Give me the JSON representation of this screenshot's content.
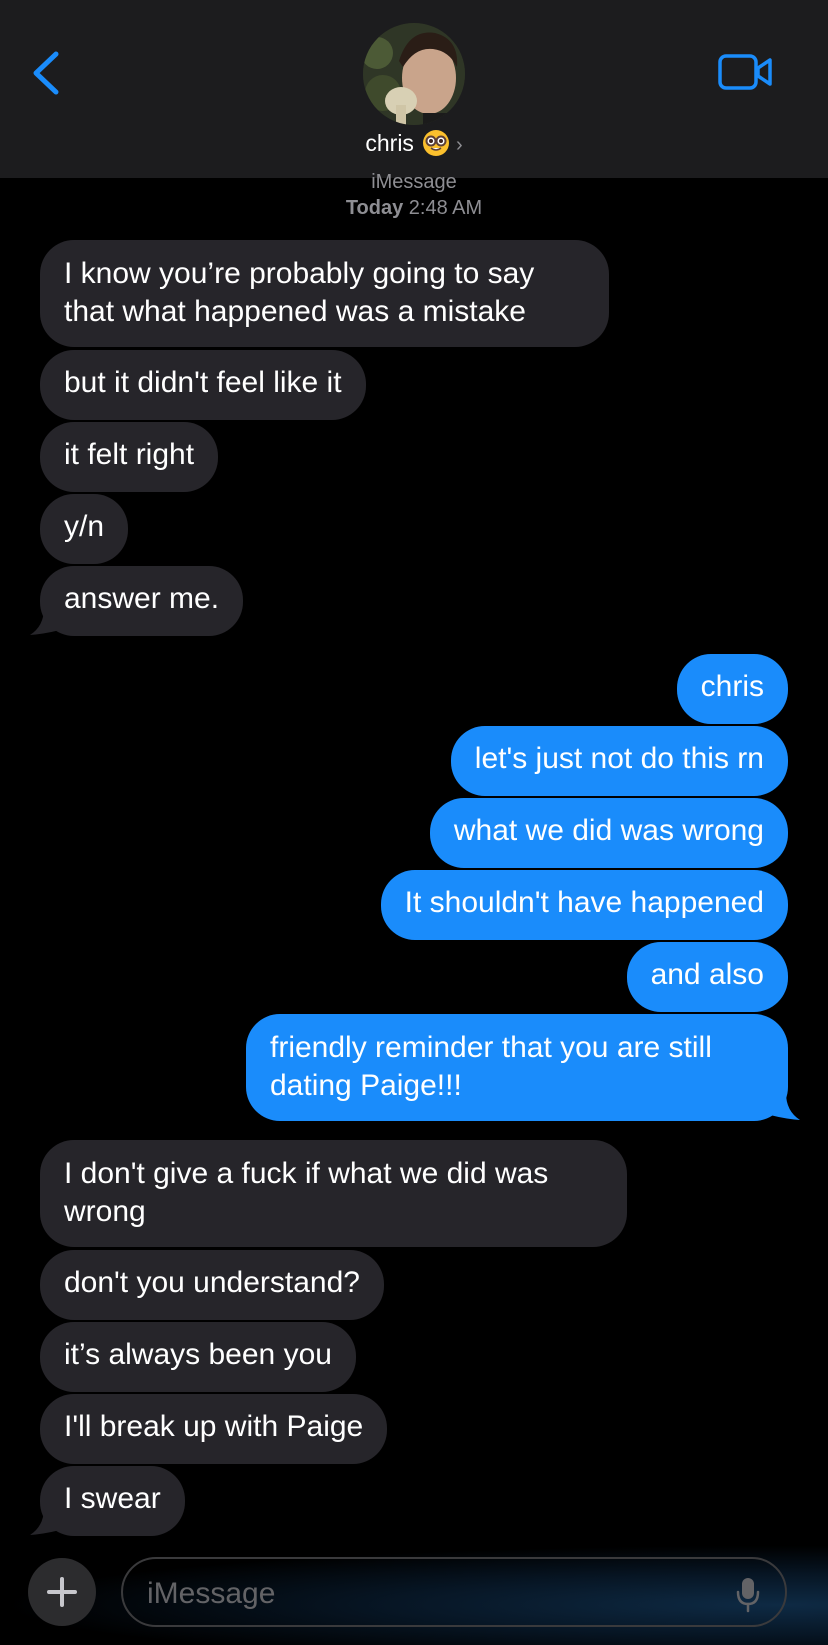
{
  "header": {
    "contact_name": "chris",
    "contact_emoji": "nerd-face-emoji",
    "back_icon": "chevron-left-icon",
    "video_icon": "video-camera-icon",
    "accent_color": "#1a8cfb"
  },
  "conversation": {
    "service_label": "iMessage",
    "timestamp_day": "Today",
    "timestamp_time": "2:48 AM"
  },
  "messages": [
    {
      "from": "contact",
      "text": "I know you’re probably going to say that what happened was a mistake"
    },
    {
      "from": "contact",
      "text": "but it didn't feel like it"
    },
    {
      "from": "contact",
      "text": "it felt right"
    },
    {
      "from": "contact",
      "text": "y/n"
    },
    {
      "from": "contact",
      "text": "answer me."
    },
    {
      "from": "me",
      "text": "chris"
    },
    {
      "from": "me",
      "text": "let's just not do this rn"
    },
    {
      "from": "me",
      "text": "what we did was wrong"
    },
    {
      "from": "me",
      "text": "It shouldn't have happened"
    },
    {
      "from": "me",
      "text": "and also"
    },
    {
      "from": "me",
      "text": "friendly reminder that you are still dating Paige!!!"
    },
    {
      "from": "contact",
      "text": "I don't give a fuck if what we did was wrong"
    },
    {
      "from": "contact",
      "text": "don't you understand?"
    },
    {
      "from": "contact",
      "text": "it’s always been you"
    },
    {
      "from": "contact",
      "text": "I'll break up with Paige"
    },
    {
      "from": "contact",
      "text": "I swear"
    }
  ],
  "composer": {
    "placeholder": "iMessage",
    "plus_icon": "plus-icon",
    "mic_icon": "microphone-icon"
  },
  "colors": {
    "received_bubble": "#26252a",
    "sent_bubble": "#1a8cfb",
    "background": "#000000",
    "header_background": "#1c1c1e"
  }
}
